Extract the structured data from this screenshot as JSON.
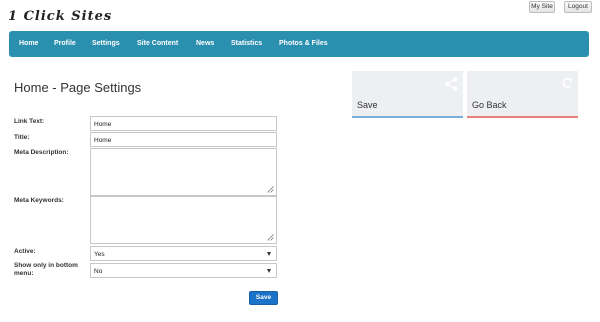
{
  "brand": {
    "logo_text": "1 Click Sites"
  },
  "top_buttons": {
    "my_site": "My Site",
    "logout": "Logout"
  },
  "nav": {
    "items": [
      {
        "label": "Home"
      },
      {
        "label": "Profile"
      },
      {
        "label": "Settings"
      },
      {
        "label": "Site Content"
      },
      {
        "label": "News"
      },
      {
        "label": "Statistics"
      },
      {
        "label": "Photos & Files"
      }
    ]
  },
  "page": {
    "title": "Home - Page Settings"
  },
  "tiles": {
    "save": {
      "label": "Save",
      "icon": "share-icon",
      "accent": "#7aaed8"
    },
    "back": {
      "label": "Go Back",
      "icon": "undo-arrow-icon",
      "accent": "#e8837a"
    }
  },
  "form": {
    "link_text": {
      "label": "Link Text:",
      "value": "Home"
    },
    "title": {
      "label": "Title:",
      "value": "Home"
    },
    "meta_description": {
      "label": "Meta Description:",
      "value": ""
    },
    "meta_keywords": {
      "label": "Meta Keywords:",
      "value": ""
    },
    "active": {
      "label": "Active:",
      "value": "Yes"
    },
    "bottom_menu": {
      "label": "Show only in bottom menu:",
      "value": "No"
    },
    "submit_label": "Save"
  },
  "colors": {
    "navbar": "#2b8fb0",
    "primary_button": "#1a73c9"
  }
}
